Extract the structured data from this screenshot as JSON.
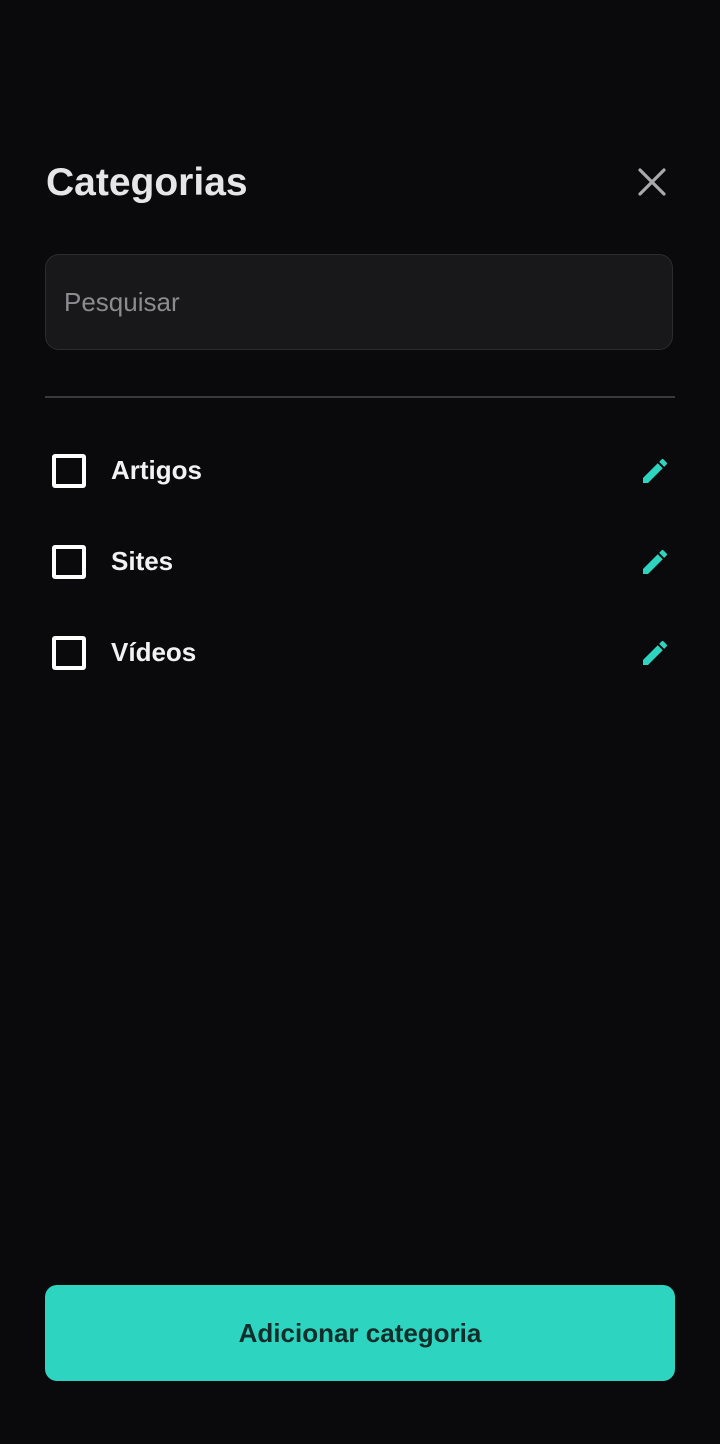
{
  "header": {
    "title": "Categorias",
    "close_icon": "close-icon"
  },
  "search": {
    "placeholder": "Pesquisar",
    "value": ""
  },
  "categories": {
    "items": [
      {
        "label": "Artigos",
        "checked": false,
        "edit_icon": "pencil-icon"
      },
      {
        "label": "Sites",
        "checked": false,
        "edit_icon": "pencil-icon"
      },
      {
        "label": "Vídeos",
        "checked": false,
        "edit_icon": "pencil-icon"
      }
    ]
  },
  "footer": {
    "add_label": "Adicionar categoria"
  },
  "colors": {
    "background": "#0a0a0c",
    "accent": "#2dd4bf",
    "search_bg": "#18181b",
    "text": "#f2f2f4",
    "placeholder": "#8b8b90"
  }
}
